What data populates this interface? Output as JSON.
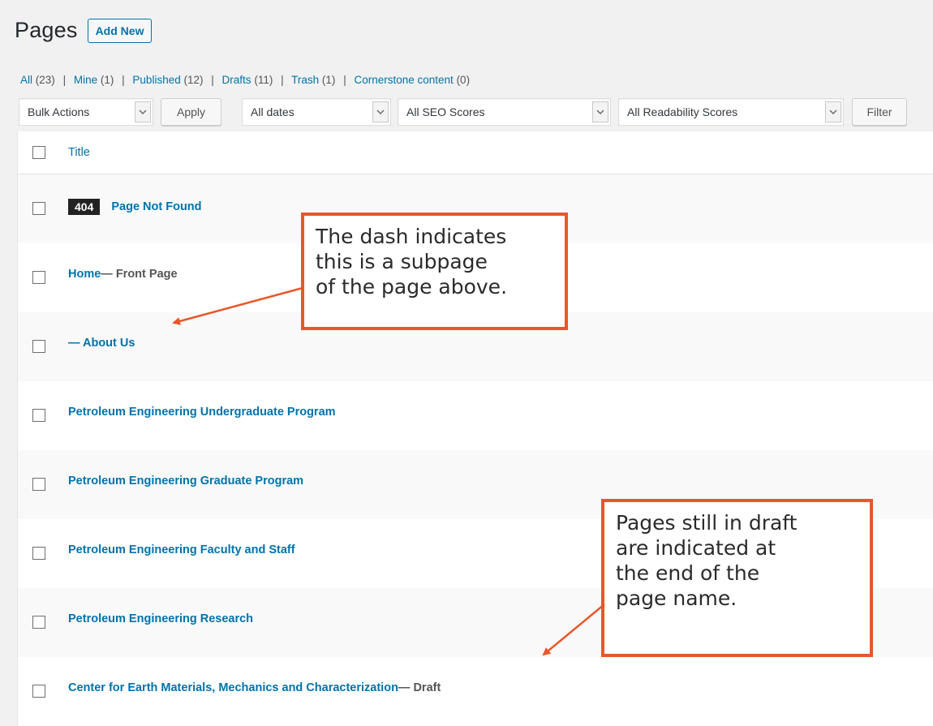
{
  "header": {
    "title": "Pages",
    "add_new": "Add New"
  },
  "views": [
    {
      "label": "All",
      "count": "(23)"
    },
    {
      "label": "Mine",
      "count": "(1)"
    },
    {
      "label": "Published",
      "count": "(12)"
    },
    {
      "label": "Drafts",
      "count": "(11)"
    },
    {
      "label": "Trash",
      "count": "(1)"
    },
    {
      "label": "Cornerstone content",
      "count": "(0)"
    }
  ],
  "filters": {
    "bulk_actions": "Bulk Actions",
    "apply": "Apply",
    "dates": "All dates",
    "seo": "All SEO Scores",
    "readability": "All Readability Scores",
    "filter": "Filter"
  },
  "table": {
    "header_title": "Title",
    "rows": [
      {
        "badge": "404",
        "title": "Page Not Found",
        "state": ""
      },
      {
        "title": "Home",
        "state": " — Front Page"
      },
      {
        "title": "— About Us",
        "state": ""
      },
      {
        "title": "Petroleum Engineering Undergraduate Program",
        "state": ""
      },
      {
        "title": "Petroleum Engineering Graduate Program",
        "state": ""
      },
      {
        "title": "Petroleum Engineering Faculty and Staff",
        "state": ""
      },
      {
        "title": "Petroleum Engineering Research",
        "state": ""
      },
      {
        "title": "Center for Earth Materials, Mechanics and Characterization",
        "state": " — Draft"
      }
    ]
  },
  "annotations": {
    "subpage_note": [
      "The dash indicates",
      "this is a subpage",
      "of the page above."
    ],
    "draft_note": [
      "Pages still in draft",
      "are indicated at",
      "the end of the",
      "page name."
    ]
  },
  "colors": {
    "link": "#0073aa",
    "callout_border": "#e8572a",
    "badge_bg": "#222222"
  }
}
